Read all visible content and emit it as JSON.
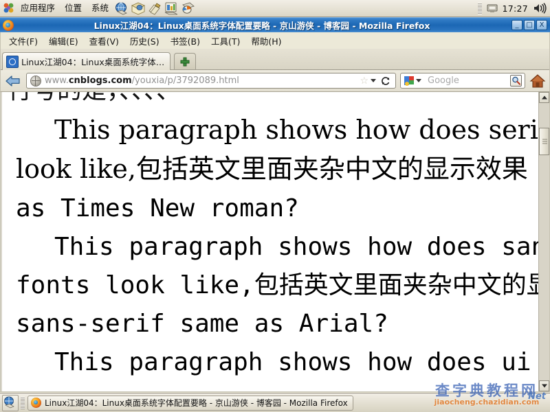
{
  "desktop_panel": {
    "menus": [
      {
        "label": "应用程序",
        "name": "panel-menu-applications"
      },
      {
        "label": "位置",
        "name": "panel-menu-places"
      },
      {
        "label": "系统",
        "name": "panel-menu-system"
      }
    ],
    "launchers": [
      {
        "icon": "web-browser-icon"
      },
      {
        "icon": "email-client-icon"
      },
      {
        "icon": "text-editor-icon"
      },
      {
        "icon": "spreadsheet-icon"
      },
      {
        "icon": "presentation-icon"
      }
    ],
    "clock": "17:27",
    "volume_icon": "speaker-icon",
    "notification_icon": "display-icon"
  },
  "window": {
    "title": "Linux江湖04：Linux桌面系统字体配置要略 - 京山游侠 - 博客园 - Mozilla Firefox",
    "app_icon": "firefox-icon",
    "buttons": {
      "minimize": "_",
      "maximize": "□",
      "close": "X"
    }
  },
  "menubar": [
    {
      "label": "文件(F)",
      "name": "menu-file"
    },
    {
      "label": "编辑(E)",
      "name": "menu-edit"
    },
    {
      "label": "查看(V)",
      "name": "menu-view"
    },
    {
      "label": "历史(S)",
      "name": "menu-history"
    },
    {
      "label": "书签(B)",
      "name": "menu-bookmarks"
    },
    {
      "label": "工具(T)",
      "name": "menu-tools"
    },
    {
      "label": "帮助(H)",
      "name": "menu-help"
    }
  ],
  "tabs": {
    "active_label": "Linux江湖04：Linux桌面系统字体…",
    "new_tab_icon": "plus-icon"
  },
  "navbar": {
    "back_icon": "back-arrow-icon",
    "url_prefix": "www.",
    "url_domain": "cnblogs.com",
    "url_path": "/youxia/p/3792089.html",
    "star_icon": "star-icon",
    "dropdown_icon": "chevron-down-icon",
    "reload_icon": "reload-icon",
    "search_engine_icon": "google-icon",
    "search_placeholder": "Google",
    "search_go_icon": "search-icon",
    "home_icon": "home-icon"
  },
  "page_content": {
    "clipped_top_line": "行号的是，、、、、",
    "lines": [
      {
        "text": "This paragraph shows how does serif eng",
        "style": "serif"
      },
      {
        "text": "look like,包括英文里面夹杂中文的显示效果",
        "style": "serif"
      },
      {
        "text": "as Times New roman?",
        "style": "serif"
      },
      {
        "text": "This paragraph shows how does sans-ser",
        "style": "mono"
      },
      {
        "text": "fonts look like,包括英文里面夹杂中文的显示",
        "style": "mono"
      },
      {
        "text": "sans-serif same as Arial?",
        "style": "mono"
      },
      {
        "text": "This paragraph shows how does ui fonts",
        "style": "mono"
      }
    ]
  },
  "scrollbar": {
    "up_icon": "scroll-up-arrow-icon",
    "down_icon": "scroll-down-arrow-icon",
    "thumb_name": "scrollbar-thumb"
  },
  "taskbar": {
    "show_desktop_icon": "show-desktop-icon",
    "window_button_label": "Linux江湖04：Linux桌面系统字体配置要略 - 京山游侠 - 博客园 - Mozilla Firefox",
    "window_button_icon": "firefox-icon"
  },
  "watermark": {
    "chinese": "查字典教程网",
    "english": "jiaocheng.chazidian.com",
    "badge": "Net"
  },
  "colors": {
    "titlebar_blue": "#1c67b4",
    "panel_beige": "#ece9d8",
    "watermark_blue": "#3b63b5",
    "watermark_orange": "#e06a10",
    "firefox_orange": "#e2641a"
  }
}
